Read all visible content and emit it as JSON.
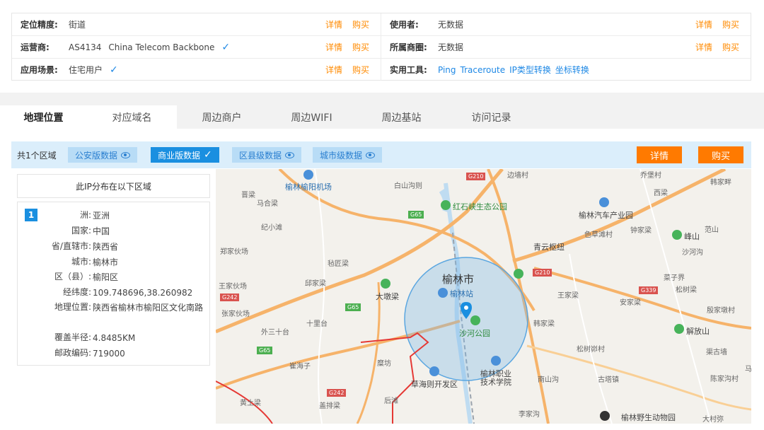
{
  "info": {
    "rows": [
      {
        "left": {
          "key": "定位精度:",
          "value": "街道"
        },
        "right": {
          "key": "使用者:",
          "value": "无数据"
        }
      },
      {
        "left": {
          "key": "运营商:",
          "value": "AS4134",
          "value2": "China Telecom Backbone"
        },
        "right": {
          "key": "所属商圈:",
          "value": "无数据"
        }
      },
      {
        "left": {
          "key": "应用场景:",
          "value": "住宅用户"
        },
        "right": {
          "key": "实用工具:"
        }
      }
    ],
    "detail_label": "详情",
    "buy_label": "购买",
    "tools": [
      "Ping",
      "Traceroute",
      "IP类型转换",
      "坐标转换"
    ],
    "check_glyph": "✓",
    "check_color": "#1e88e5",
    "action_color": "#ff8a00"
  },
  "tabs": [
    "地理位置",
    "对应域名",
    "周边商户",
    "周边WIFI",
    "周边基站",
    "访问记录"
  ],
  "filter": {
    "region_count": "共1个区域",
    "buttons": [
      "公安版数据",
      "商业版数据",
      "区县级数据",
      "城市级数据"
    ],
    "detail_label": "详情",
    "buy_label": "购买",
    "accent": "#ff7a00"
  },
  "distribution": {
    "title": "此IP分布在以下区域",
    "index": "1",
    "rows": [
      {
        "key": "洲:",
        "value": "亚洲"
      },
      {
        "key": "国家:",
        "value": "中国"
      },
      {
        "key": "省/直辖市:",
        "value": "陕西省"
      },
      {
        "key": "城市:",
        "value": "榆林市"
      },
      {
        "key": "区（县）:",
        "value": "榆阳区"
      },
      {
        "key": "经纬度:",
        "value": "109.748696,38.260982"
      },
      {
        "key": "地理位置:",
        "value": "陕西省榆林市榆阳区文化南路"
      },
      {
        "key": "覆盖半径:",
        "value": "4.8485KM"
      },
      {
        "key": "邮政编码:",
        "value": "719000"
      }
    ]
  },
  "map": {
    "labels": {
      "airport": "榆林榆阳机场",
      "city": "榆林市",
      "station": "榆林站",
      "park_shahe": "沙河公园",
      "park_hongshixia": "红石峡生态公园",
      "qingyun": "青云枢纽",
      "auto_park": "榆林汽车产业园",
      "fengshan": "峰山",
      "jiefangshan": "解放山",
      "dadunliang": "大墩梁",
      "caohaize": "草海则开发区",
      "college": "榆林职业技术学院",
      "zoo": "榆林野生动物园",
      "jinmeng": "晋梁",
      "madasahng": "马合梁",
      "jixiaohao": "纪小滩",
      "zhengjia": "郑家伙场",
      "wangjia": "王家伙场",
      "zhangjia": "张家伙场",
      "waisan": "外三十台",
      "shiliban": "十里台",
      "cuihaizi": "崔海子",
      "huangtu": "黄土梁",
      "gaihuang": "盖排梁",
      "houwa": "后滩",
      "mihuo": "糜坊",
      "baishan": "白山沟则",
      "sejuqiao": "色草滩村",
      "zhongjia": "钟家梁",
      "shahegou": "沙河沟",
      "caiziyan": "菜子界",
      "songshu": "松树梁",
      "anjia": "安家梁",
      "wangjialiang": "王家梁",
      "hanjiadiao": "韩家梁",
      "songsha": "松树峁村",
      "gutawo": "古塔镇",
      "nanshan": "南山沟",
      "lijia": "李家沟",
      "datong": "大村弥",
      "qiaojia": "乔堡村",
      "xiqiao": "西梁",
      "hanjia": "韩家畔",
      "fanshan": "范山",
      "yinjia": "殷家墩村",
      "qujia": "渠古墙",
      "chenjia": "陈家沟村",
      "fudiguo": "邱家梁",
      "bianqiang": "边墙村",
      "daqiangou": "毡匠梁",
      "hu": "马"
    },
    "shields": [
      "G210",
      "G65",
      "G242",
      "G65",
      "G210",
      "G65",
      "G339",
      "G242",
      "G65"
    ],
    "land_color": "#f3f1ec",
    "road_color": "#f6b36a",
    "river_color": "#bfdcf1",
    "circle_color": "#7ab8e8",
    "border_color": "#e53935"
  }
}
